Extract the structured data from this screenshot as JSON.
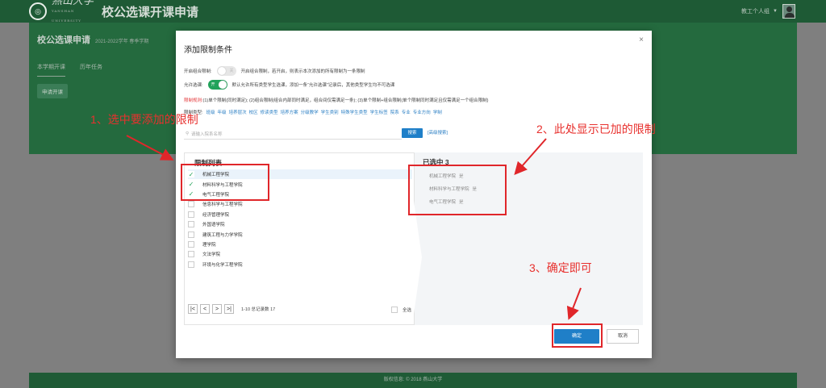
{
  "header": {
    "logo_text": "燕山大学",
    "logo_sub": "YANSHAN UNIVERSITY",
    "app_title": "校公选课开课申请",
    "user_label": "教工个人组"
  },
  "page": {
    "title": "校公选课申请",
    "term": "2021-2022学年 春季学期",
    "tabs": [
      "本学期开课",
      "历年任务"
    ],
    "apply_button": "申请开课"
  },
  "modal": {
    "title": "添加限制条件",
    "close": "×",
    "combo_label": "开启组合限制:",
    "combo_toggle": "关",
    "combo_desc": "开启组合限制，若开启，则表示本次添加的所有限制为一条限制",
    "allow_label": "允许选课:",
    "allow_toggle": "开",
    "allow_desc": "默认允许所有类型学生选课，添加一条“允许选课”记录后，其他类型学生均不可选课",
    "rule_label": "限制规则:",
    "rule_text": "(1)单个限制(同时满足); (2)组合限制(组合内部同时满足，组合间仅需满足一条); (3)单个限制+组合限制(单个限制同时满足且仅需满足一个组合限制)",
    "type_label": "限制类型:",
    "types": [
      "班级",
      "年级",
      "培养层次",
      "校区",
      "修读类型",
      "培养方案",
      "分级教学",
      "学生类别",
      "特殊学生类型",
      "学生标签",
      "院系",
      "专业",
      "专业方向",
      "学制"
    ],
    "search_placeholder": "请输入院系名称",
    "search_button": "搜索",
    "advanced_search": "[高级搜索]",
    "list_title": "限制列表",
    "list_items": [
      {
        "label": "机械工程学院",
        "checked": true
      },
      {
        "label": "材料科学与工程学院",
        "checked": true
      },
      {
        "label": "电气工程学院",
        "checked": true
      },
      {
        "label": "信息科学与工程学院",
        "checked": false
      },
      {
        "label": "经济管理学院",
        "checked": false
      },
      {
        "label": "外国语学院",
        "checked": false
      },
      {
        "label": "建筑工程与力学学院",
        "checked": false
      },
      {
        "label": "理学院",
        "checked": false
      },
      {
        "label": "文法学院",
        "checked": false
      },
      {
        "label": "环境与化学工程学院",
        "checked": false
      }
    ],
    "pager": {
      "first": "|<",
      "prev": "<",
      "next": ">",
      "last": ">|",
      "info": "1-10 总记录数 17"
    },
    "select_all": "全选",
    "selected_title": "已选中 3",
    "selected_items": [
      {
        "label": "机械工程学院",
        "flag": "是"
      },
      {
        "label": "材料科学与工程学院",
        "flag": "是"
      },
      {
        "label": "电气工程学院",
        "flag": "是"
      }
    ],
    "ok_button": "确定",
    "cancel_button": "取消"
  },
  "annotations": {
    "step1": "1、选中要添加的限制",
    "step2": "2、此处显示已加的限制",
    "step3": "3、确定即可"
  },
  "footer": "版权信息: © 2018 燕山大学",
  "colors": {
    "annotation": "#e0262a",
    "primary": "#1f7fc8",
    "header": "#1e5a35",
    "check": "#25a35a"
  }
}
